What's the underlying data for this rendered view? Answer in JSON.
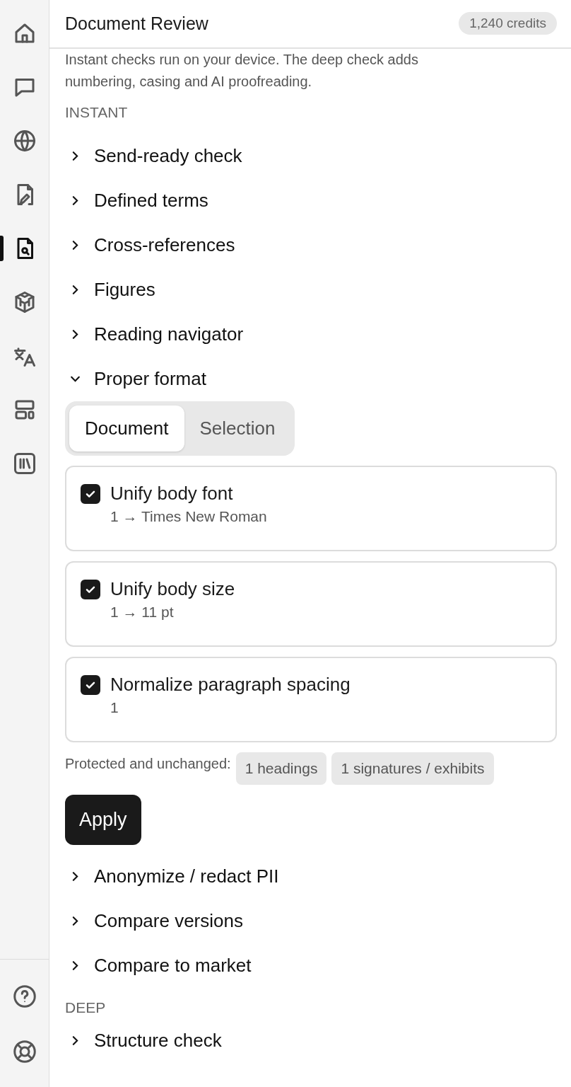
{
  "sidebar": {
    "items": [
      {
        "kind": "home",
        "selected": false
      },
      {
        "kind": "chat",
        "selected": false
      },
      {
        "kind": "globe",
        "selected": false
      },
      {
        "kind": "doc-edit",
        "selected": false
      },
      {
        "kind": "doc-search",
        "selected": true
      },
      {
        "kind": "cube",
        "selected": false
      },
      {
        "kind": "translate",
        "selected": false
      },
      {
        "kind": "layout",
        "selected": false
      },
      {
        "kind": "library",
        "selected": false
      }
    ],
    "bottom_items": [
      {
        "kind": "help",
        "selected": false
      },
      {
        "kind": "support",
        "selected": false
      }
    ]
  },
  "header": {
    "title": "Document Review",
    "credits": "1,240 credits"
  },
  "intro": [
    "Instant checks run on your device. The deep check adds",
    "numbering, casing and AI proofreading."
  ],
  "sections": [
    {
      "label": "INSTANT",
      "items": [
        {
          "title": "Send-ready check",
          "expanded": false
        },
        {
          "title": "Defined terms",
          "expanded": false
        },
        {
          "title": "Cross-references",
          "expanded": false
        },
        {
          "title": "Figures",
          "expanded": false
        },
        {
          "title": "Reading navigator",
          "expanded": false
        },
        {
          "title": "Proper format",
          "expanded": true,
          "tabs": [
            {
              "label": "Document",
              "selected": true
            },
            {
              "label": "Selection",
              "selected": false
            }
          ],
          "options": [
            {
              "title": "Unify body font",
              "detail": "1 → Times New Roman",
              "checked": true
            },
            {
              "title": "Unify body size",
              "detail": "1 → 11 pt",
              "checked": true
            },
            {
              "title": "Normalize paragraph spacing",
              "detail": "1",
              "checked": true
            }
          ],
          "protected_label": "Protected and unchanged:",
          "protected_tags": [
            "1 headings",
            "1 signatures / exhibits"
          ],
          "apply": "Apply"
        },
        {
          "title": "Anonymize / redact PII",
          "expanded": false
        },
        {
          "title": "Compare versions",
          "expanded": false
        },
        {
          "title": "Compare to market",
          "expanded": false
        }
      ]
    },
    {
      "label": "DEEP",
      "items": [
        {
          "title": "Structure check",
          "expanded": false
        }
      ]
    }
  ]
}
